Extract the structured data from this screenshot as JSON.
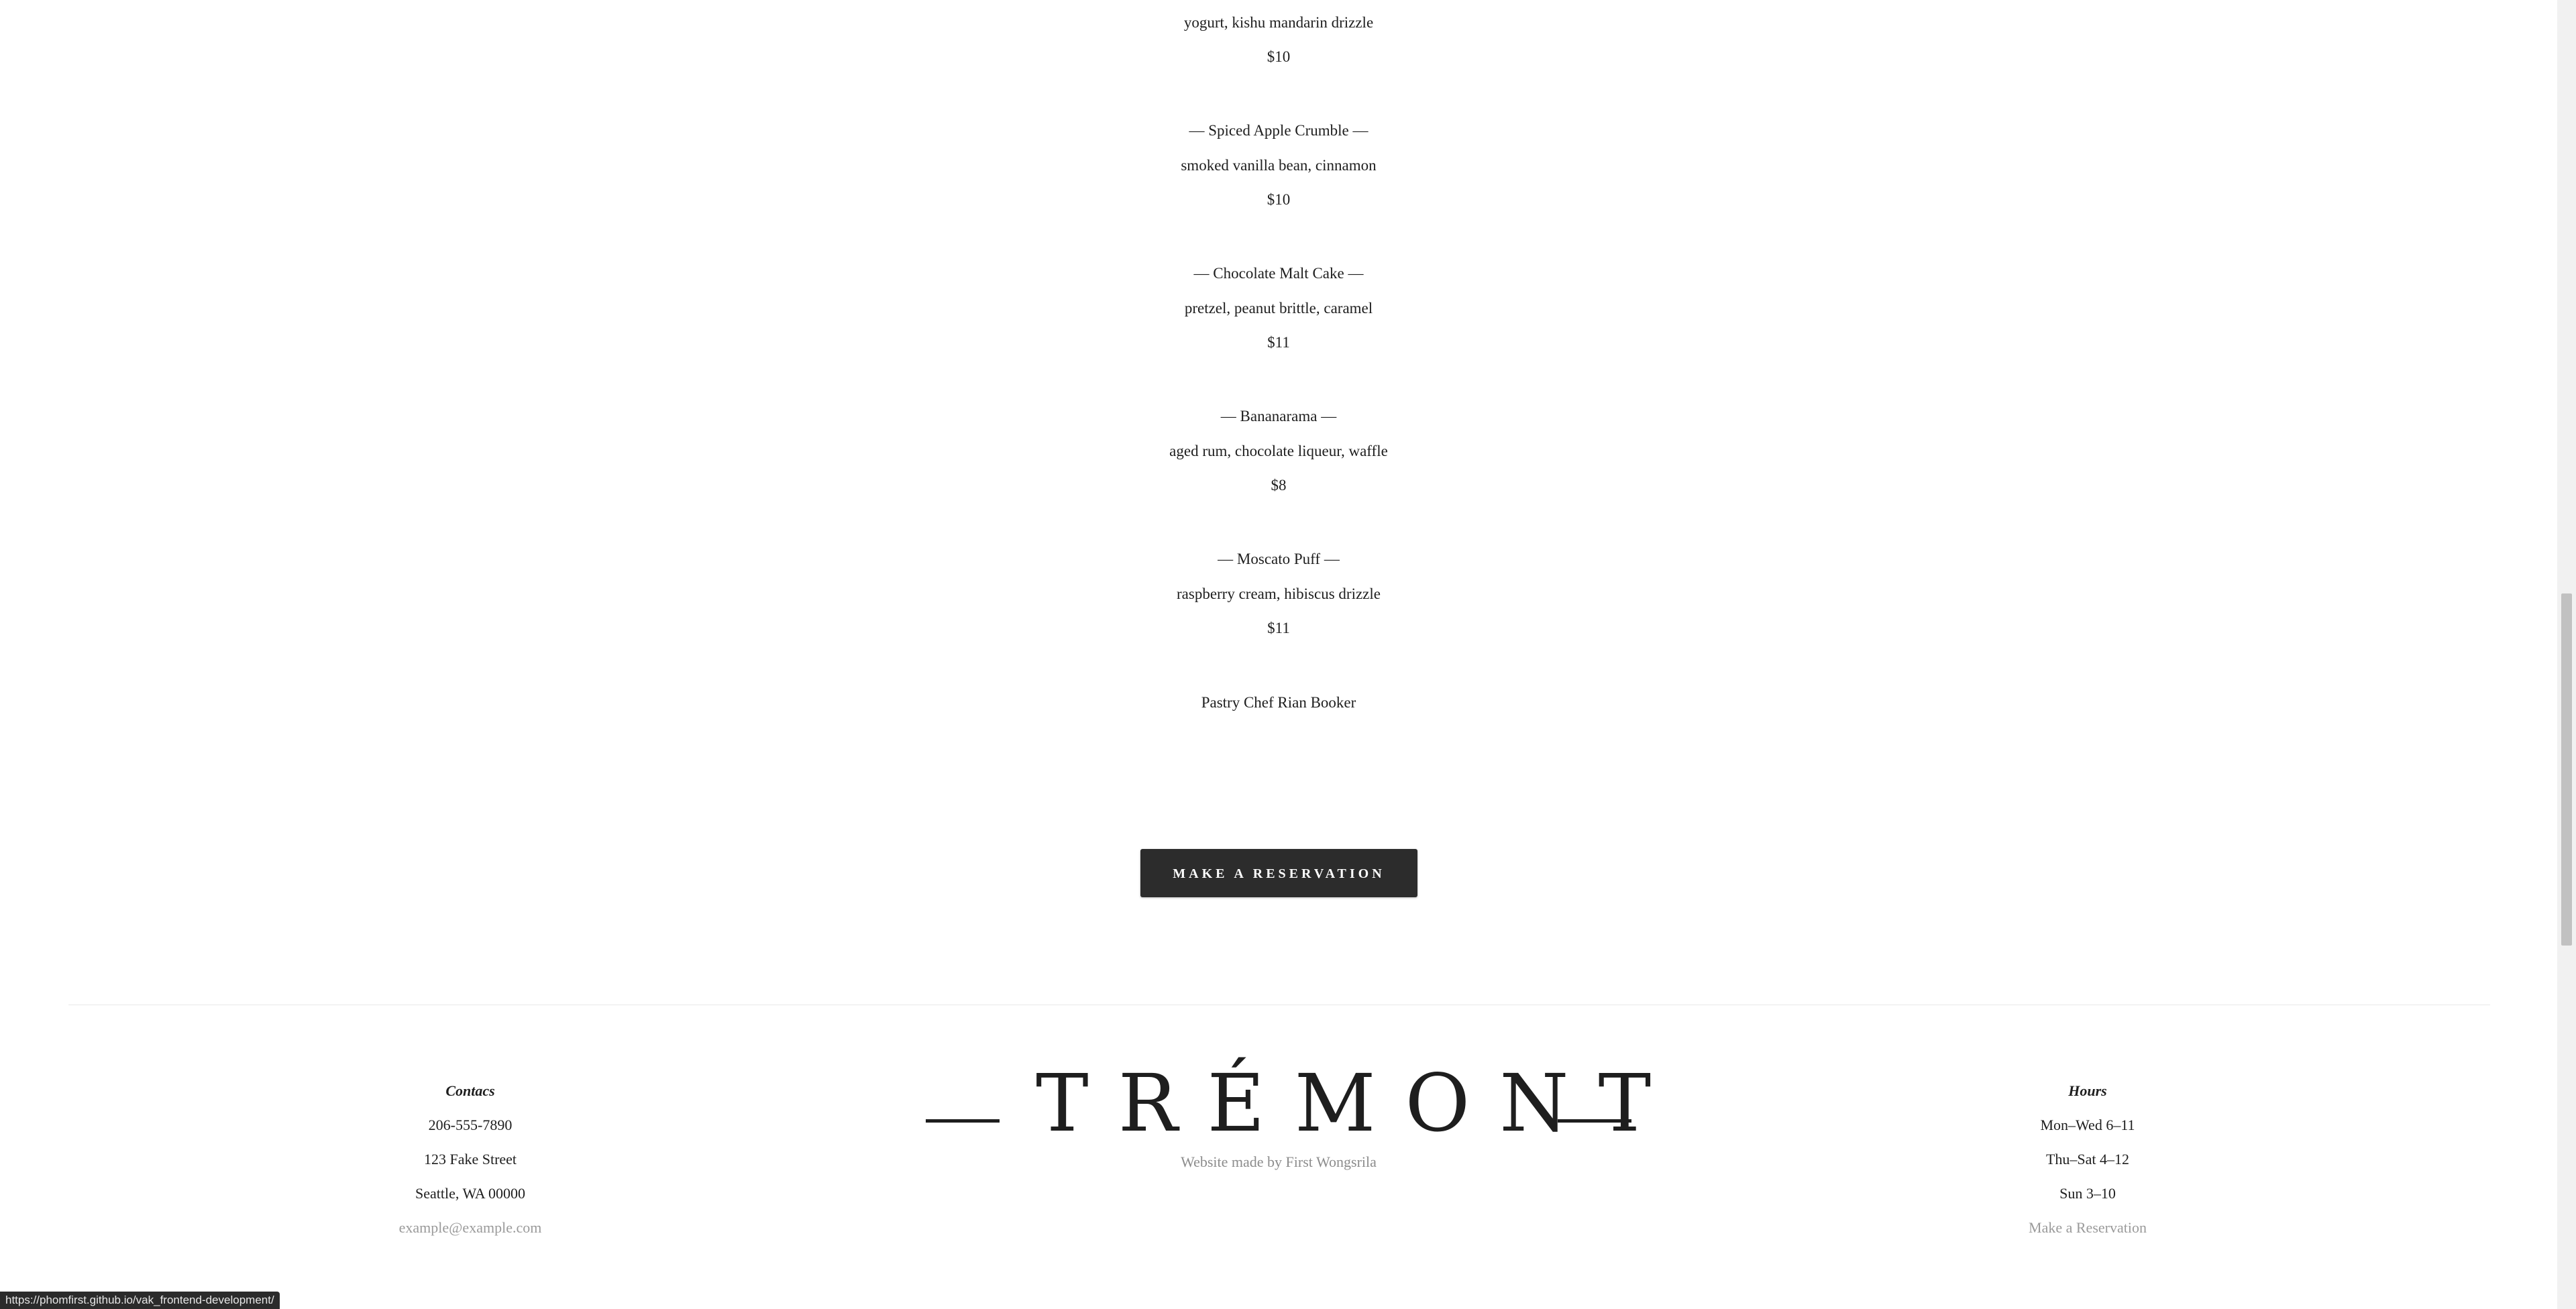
{
  "menu": {
    "items": [
      {
        "name": "",
        "description": "yogurt, kishu mandarin drizzle",
        "price": "$10"
      },
      {
        "name": "— Spiced Apple Crumble —",
        "description": "smoked vanilla bean, cinnamon",
        "price": "$10"
      },
      {
        "name": "— Chocolate Malt Cake —",
        "description": "pretzel, peanut brittle, caramel",
        "price": "$11"
      },
      {
        "name": "— Bananarama —",
        "description": "aged rum, chocolate liqueur, waffle",
        "price": "$8"
      },
      {
        "name": "— Moscato Puff —",
        "description": "raspberry cream, hibiscus drizzle",
        "price": "$11"
      }
    ],
    "chef": "Pastry Chef Rian Booker"
  },
  "reservation_button": {
    "label": "MAKE A RESERVATION"
  },
  "footer": {
    "contacts": {
      "heading": "Contacs",
      "phone": "206-555-7890",
      "street": "123 Fake Street",
      "city": "Seattle, WA 00000",
      "email": "example@example.com"
    },
    "logo": "TRÉMONT",
    "credit": "Website made by First Wongsrila",
    "hours": {
      "heading": "Hours",
      "lines": [
        "Mon–Wed 6–11",
        "Thu–Sat 4–12",
        "Sun 3–10"
      ],
      "link": "Make a Reservation"
    }
  },
  "status_bar": {
    "url": "https://phomfirst.github.io/vak_frontend-development/"
  },
  "colors": {
    "text": "#1e1e1e",
    "button_bg": "#2c2c2c",
    "muted_link": "#9a9a9a"
  }
}
